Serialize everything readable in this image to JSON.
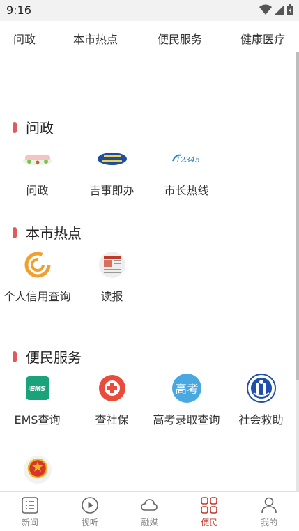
{
  "status_bar": {
    "time": "9:16"
  },
  "top_tabs": [
    "问政",
    "本市热点",
    "便民服务",
    "健康医疗"
  ],
  "sections": [
    {
      "title": "问政",
      "items": [
        {
          "label": "问政",
          "icon": "wenzheng-logo-icon"
        },
        {
          "label": "吉事即办",
          "icon": "jishijiban-logo-icon"
        },
        {
          "label": "市长热线",
          "icon": "hotline-12345-icon"
        }
      ]
    },
    {
      "title": "本市热点",
      "items": [
        {
          "label": "个人信用查询",
          "icon": "credit-icon"
        },
        {
          "label": "读报",
          "icon": "newspaper-icon"
        }
      ]
    },
    {
      "title": "便民服务",
      "items": [
        {
          "label": "EMS查询",
          "icon": "ems-icon"
        },
        {
          "label": "查社保",
          "icon": "social-security-icon"
        },
        {
          "label": "高考录取查询",
          "icon": "gaokao-icon",
          "icon_text": "高考"
        },
        {
          "label": "社会救助",
          "icon": "social-aid-icon"
        },
        {
          "label": "",
          "icon": "national-emblem-icon"
        }
      ]
    }
  ],
  "hotline_icon_text": "12345",
  "ems_icon_text": "EMS",
  "bottom_nav": [
    {
      "label": "新闻",
      "icon": "news-icon",
      "active": false
    },
    {
      "label": "视听",
      "icon": "play-icon",
      "active": false
    },
    {
      "label": "融媒",
      "icon": "cloud-icon",
      "active": false
    },
    {
      "label": "便民",
      "icon": "grid-icon",
      "active": true
    },
    {
      "label": "我的",
      "icon": "user-icon",
      "active": false
    }
  ],
  "colors": {
    "accent": "#c0392b",
    "section_bar": "#e05a5a"
  }
}
